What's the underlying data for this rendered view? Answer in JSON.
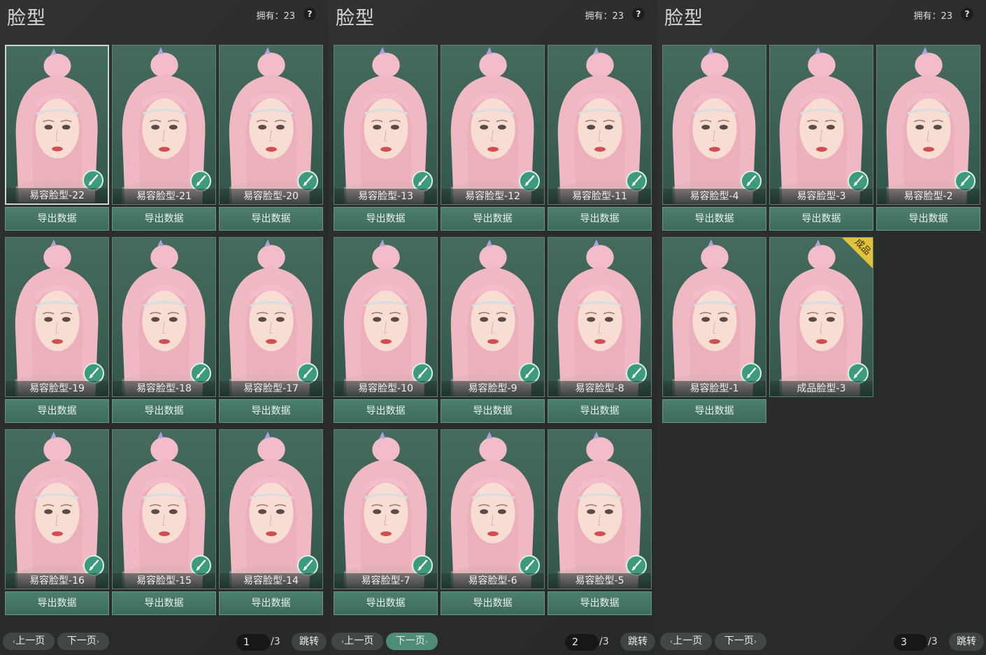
{
  "colors": {
    "accent": "#4f8c78",
    "card_bg": "#3f6357",
    "hair": "#f0b8c3",
    "badge": "#3c9a7d",
    "tag": "#e1c23a"
  },
  "export_label": "导出数据",
  "edit_icon": "brush-icon",
  "panels": [
    {
      "title": "脸型",
      "owned": "拥有：23",
      "help": "?",
      "prev": "上一页",
      "next": "下一页",
      "page_value": "1",
      "page_total": "/3",
      "jump": "跳转",
      "active_nav": "none",
      "cards": [
        {
          "label": "易容脸型-22",
          "selected": true,
          "export": true
        },
        {
          "label": "易容脸型-21",
          "export": true
        },
        {
          "label": "易容脸型-20",
          "export": true
        },
        {
          "label": "易容脸型-19",
          "export": true
        },
        {
          "label": "易容脸型-18",
          "export": true
        },
        {
          "label": "易容脸型-17",
          "export": true
        },
        {
          "label": "易容脸型-16",
          "export": true
        },
        {
          "label": "易容脸型-15",
          "export": true
        },
        {
          "label": "易容脸型-14",
          "export": true
        }
      ]
    },
    {
      "title": "脸型",
      "owned": "拥有：23",
      "help": "?",
      "prev": "上一页",
      "next": "下一页",
      "page_value": "2",
      "page_total": "/3",
      "jump": "跳转",
      "active_nav": "next",
      "cards": [
        {
          "label": "易容脸型-13",
          "export": true
        },
        {
          "label": "易容脸型-12",
          "export": true
        },
        {
          "label": "易容脸型-11",
          "export": true
        },
        {
          "label": "易容脸型-10",
          "export": true
        },
        {
          "label": "易容脸型-9",
          "export": true
        },
        {
          "label": "易容脸型-8",
          "export": true
        },
        {
          "label": "易容脸型-7",
          "export": true
        },
        {
          "label": "易容脸型-6",
          "export": true
        },
        {
          "label": "易容脸型-5",
          "export": true
        }
      ]
    },
    {
      "title": "脸型",
      "owned": "拥有：23",
      "help": "?",
      "prev": "上一页",
      "next": "下一页",
      "page_value": "3",
      "page_total": "/3",
      "jump": "跳转",
      "active_nav": "none",
      "cards": [
        {
          "label": "易容脸型-4",
          "export": true
        },
        {
          "label": "易容脸型-3",
          "export": true
        },
        {
          "label": "易容脸型-2",
          "export": true
        },
        {
          "label": "易容脸型-1",
          "export": true
        },
        {
          "label": "成品脸型-3",
          "export": false,
          "tag": "成品"
        }
      ]
    }
  ]
}
